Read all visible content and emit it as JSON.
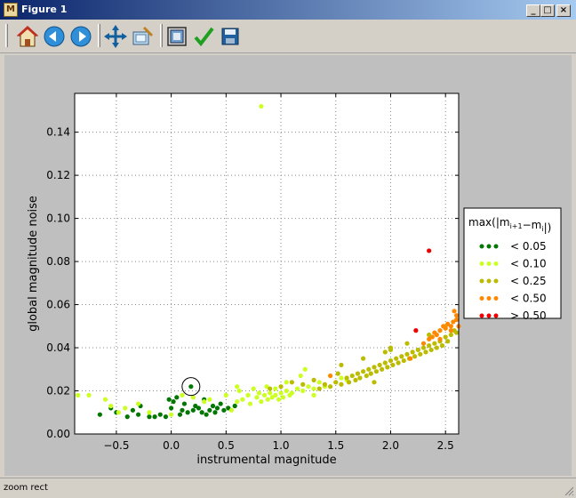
{
  "window": {
    "title": "Figure 1",
    "app_icon_glyph": "M",
    "minimize": "_",
    "maximize": "□",
    "close": "×"
  },
  "toolbar": {
    "buttons": [
      {
        "name": "home-icon"
      },
      {
        "name": "back-icon"
      },
      {
        "name": "forward-icon"
      },
      {
        "name": "pan-icon"
      },
      {
        "name": "zoom-rect-icon"
      },
      {
        "name": "subplots-icon"
      },
      {
        "name": "checkmark-icon"
      },
      {
        "name": "save-icon"
      }
    ]
  },
  "status": {
    "text": "zoom rect"
  },
  "colors": {
    "lt005": "#007700",
    "lt010": "#ccff22",
    "lt025": "#bbbb00",
    "lt050": "#ff8800",
    "gt050": "#ee0000"
  },
  "chart_data": {
    "type": "scatter",
    "xlabel": "instrumental magnitude",
    "ylabel": "global magnitude noise",
    "xlim": [
      -0.88,
      2.62
    ],
    "ylim": [
      0.0,
      0.158
    ],
    "xticks": [
      -0.5,
      0.0,
      0.5,
      1.0,
      1.5,
      2.0,
      2.5
    ],
    "xtick_labels": [
      "−0.5",
      "0.0",
      "0.5",
      "1.0",
      "1.5",
      "2.0",
      "2.5"
    ],
    "yticks": [
      0.0,
      0.02,
      0.04,
      0.06,
      0.08,
      0.1,
      0.12,
      0.14
    ],
    "ytick_labels": [
      "0.00",
      "0.02",
      "0.04",
      "0.06",
      "0.08",
      "0.10",
      "0.12",
      "0.14"
    ],
    "grid": true,
    "legend": {
      "title_prefix": "max(",
      "title_expr": "|m",
      "title_sub1": "i+1",
      "title_mid": "−m",
      "title_sub2": "i",
      "title_suffix": "|)",
      "placement": "outside-right",
      "entries": [
        {
          "label": "< 0.05",
          "color": "#007700"
        },
        {
          "label": "< 0.10",
          "color": "#ccff22"
        },
        {
          "label": "< 0.25",
          "color": "#bbbb00"
        },
        {
          "label": "< 0.50",
          "color": "#ff8800"
        },
        {
          "label": "> 0.50",
          "color": "#ee0000"
        }
      ]
    },
    "highlight": {
      "x": 0.18,
      "y": 0.022
    },
    "series": [
      {
        "name": "< 0.05",
        "color": "#007700",
        "points": [
          [
            -0.65,
            0.009
          ],
          [
            -0.55,
            0.012
          ],
          [
            -0.5,
            0.01
          ],
          [
            -0.4,
            0.008
          ],
          [
            -0.35,
            0.011
          ],
          [
            -0.3,
            0.009
          ],
          [
            -0.28,
            0.013
          ],
          [
            -0.2,
            0.008
          ],
          [
            -0.15,
            0.008
          ],
          [
            -0.1,
            0.009
          ],
          [
            -0.05,
            0.008
          ],
          [
            0.0,
            0.012
          ],
          [
            0.02,
            0.015
          ],
          [
            0.05,
            0.017
          ],
          [
            0.08,
            0.009
          ],
          [
            0.1,
            0.011
          ],
          [
            0.12,
            0.014
          ],
          [
            0.15,
            0.01
          ],
          [
            0.18,
            0.022
          ],
          [
            0.2,
            0.011
          ],
          [
            0.25,
            0.012
          ],
          [
            0.28,
            0.01
          ],
          [
            0.32,
            0.009
          ],
          [
            0.35,
            0.011
          ],
          [
            0.38,
            0.013
          ],
          [
            0.4,
            0.01
          ],
          [
            0.42,
            0.012
          ],
          [
            0.48,
            0.011
          ],
          [
            0.52,
            0.012
          ],
          [
            0.58,
            0.013
          ],
          [
            0.3,
            0.016
          ],
          [
            0.22,
            0.013
          ],
          [
            -0.02,
            0.016
          ],
          [
            0.45,
            0.014
          ]
        ]
      },
      {
        "name": "< 0.10",
        "color": "#ccff22",
        "points": [
          [
            0.82,
            0.152
          ],
          [
            -0.85,
            0.018
          ],
          [
            -0.75,
            0.018
          ],
          [
            -0.6,
            0.016
          ],
          [
            -0.55,
            0.013
          ],
          [
            -0.48,
            0.01
          ],
          [
            -0.42,
            0.012
          ],
          [
            -0.3,
            0.014
          ],
          [
            -0.2,
            0.01
          ],
          [
            0.0,
            0.009
          ],
          [
            0.1,
            0.018
          ],
          [
            0.2,
            0.017
          ],
          [
            0.3,
            0.015
          ],
          [
            0.35,
            0.016
          ],
          [
            0.5,
            0.018
          ],
          [
            0.55,
            0.011
          ],
          [
            0.6,
            0.015
          ],
          [
            0.62,
            0.02
          ],
          [
            0.65,
            0.016
          ],
          [
            0.7,
            0.018
          ],
          [
            0.72,
            0.014
          ],
          [
            0.75,
            0.021
          ],
          [
            0.78,
            0.017
          ],
          [
            0.8,
            0.019
          ],
          [
            0.82,
            0.015
          ],
          [
            0.85,
            0.018
          ],
          [
            0.88,
            0.016
          ],
          [
            0.9,
            0.019
          ],
          [
            0.92,
            0.017
          ],
          [
            0.95,
            0.018
          ],
          [
            0.98,
            0.016
          ],
          [
            1.0,
            0.019
          ],
          [
            1.02,
            0.017
          ],
          [
            1.05,
            0.02
          ],
          [
            1.08,
            0.018
          ],
          [
            1.1,
            0.019
          ],
          [
            1.15,
            0.021
          ],
          [
            1.2,
            0.02
          ],
          [
            1.25,
            0.022
          ],
          [
            1.3,
            0.021
          ],
          [
            1.35,
            0.024
          ],
          [
            1.4,
            0.022
          ],
          [
            1.45,
            0.027
          ],
          [
            1.5,
            0.024
          ],
          [
            1.55,
            0.026
          ],
          [
            1.6,
            0.025
          ],
          [
            0.6,
            0.022
          ],
          [
            0.87,
            0.022
          ],
          [
            1.18,
            0.027
          ],
          [
            1.22,
            0.03
          ],
          [
            1.05,
            0.024
          ],
          [
            0.95,
            0.021
          ],
          [
            1.3,
            0.018
          ]
        ]
      },
      {
        "name": "< 0.25",
        "color": "#bbbb00",
        "points": [
          [
            0.9,
            0.021
          ],
          [
            1.0,
            0.022
          ],
          [
            1.1,
            0.024
          ],
          [
            1.2,
            0.023
          ],
          [
            1.3,
            0.025
          ],
          [
            1.35,
            0.021
          ],
          [
            1.4,
            0.023
          ],
          [
            1.45,
            0.022
          ],
          [
            1.5,
            0.024
          ],
          [
            1.52,
            0.028
          ],
          [
            1.55,
            0.023
          ],
          [
            1.6,
            0.026
          ],
          [
            1.62,
            0.024
          ],
          [
            1.65,
            0.027
          ],
          [
            1.68,
            0.025
          ],
          [
            1.7,
            0.028
          ],
          [
            1.72,
            0.026
          ],
          [
            1.75,
            0.029
          ],
          [
            1.78,
            0.027
          ],
          [
            1.8,
            0.03
          ],
          [
            1.82,
            0.028
          ],
          [
            1.85,
            0.031
          ],
          [
            1.87,
            0.029
          ],
          [
            1.9,
            0.032
          ],
          [
            1.92,
            0.03
          ],
          [
            1.95,
            0.033
          ],
          [
            1.97,
            0.031
          ],
          [
            2.0,
            0.034
          ],
          [
            2.02,
            0.032
          ],
          [
            2.05,
            0.035
          ],
          [
            2.07,
            0.033
          ],
          [
            2.1,
            0.036
          ],
          [
            2.12,
            0.034
          ],
          [
            2.15,
            0.037
          ],
          [
            2.17,
            0.035
          ],
          [
            2.2,
            0.038
          ],
          [
            2.22,
            0.036
          ],
          [
            2.25,
            0.039
          ],
          [
            2.27,
            0.037
          ],
          [
            2.3,
            0.04
          ],
          [
            2.32,
            0.038
          ],
          [
            2.35,
            0.041
          ],
          [
            2.37,
            0.039
          ],
          [
            2.4,
            0.042
          ],
          [
            2.42,
            0.04
          ],
          [
            2.45,
            0.043
          ],
          [
            2.47,
            0.041
          ],
          [
            2.5,
            0.045
          ],
          [
            2.52,
            0.043
          ],
          [
            2.55,
            0.046
          ],
          [
            2.58,
            0.048
          ],
          [
            2.6,
            0.047
          ],
          [
            2.0,
            0.04
          ],
          [
            2.0,
            0.039
          ],
          [
            1.55,
            0.032
          ],
          [
            1.75,
            0.035
          ],
          [
            1.95,
            0.038
          ],
          [
            2.15,
            0.042
          ],
          [
            2.35,
            0.046
          ],
          [
            2.5,
            0.05
          ],
          [
            1.85,
            0.024
          ]
        ]
      },
      {
        "name": "< 0.50",
        "color": "#ff8800",
        "points": [
          [
            1.45,
            0.027
          ],
          [
            2.18,
            0.035
          ],
          [
            2.3,
            0.042
          ],
          [
            2.35,
            0.044
          ],
          [
            2.38,
            0.045
          ],
          [
            2.4,
            0.047
          ],
          [
            2.42,
            0.046
          ],
          [
            2.45,
            0.048
          ],
          [
            2.48,
            0.05
          ],
          [
            2.5,
            0.049
          ],
          [
            2.52,
            0.051
          ],
          [
            2.55,
            0.05
          ],
          [
            2.57,
            0.052
          ],
          [
            2.6,
            0.053
          ],
          [
            2.6,
            0.055
          ],
          [
            2.55,
            0.048
          ],
          [
            2.45,
            0.044
          ],
          [
            2.58,
            0.057
          ],
          [
            2.62,
            0.05
          ]
        ]
      },
      {
        "name": "> 0.50",
        "color": "#ee0000",
        "points": [
          [
            2.35,
            0.085
          ],
          [
            2.23,
            0.048
          ]
        ]
      }
    ]
  }
}
